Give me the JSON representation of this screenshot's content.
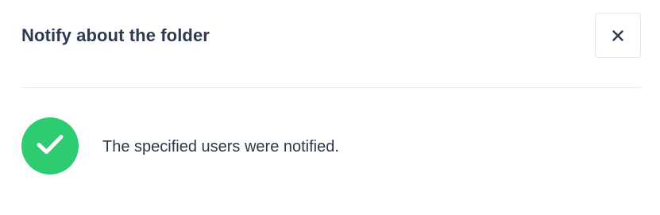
{
  "dialog": {
    "title": "Notify about the folder",
    "close_icon": "close-icon",
    "message": "The specified users were notified.",
    "status_icon": "checkmark-icon",
    "colors": {
      "success": "#2ecc71",
      "text": "#2d3748",
      "border": "#e2e5ea"
    }
  }
}
